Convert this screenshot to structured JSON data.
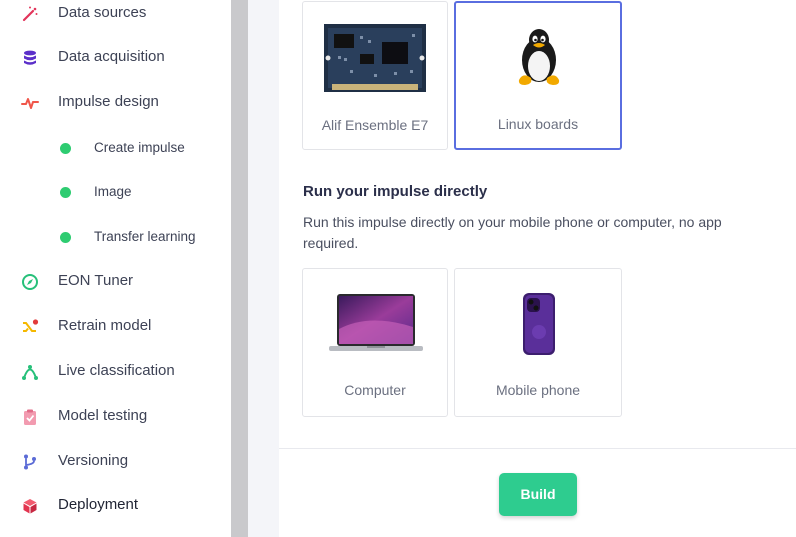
{
  "sidebar": {
    "items": [
      {
        "label": "Data sources",
        "icon": "magic-wand-icon"
      },
      {
        "label": "Data acquisition",
        "icon": "database-icon"
      },
      {
        "label": "Impulse design",
        "icon": "pulse-icon"
      },
      {
        "label": "EON Tuner",
        "icon": "compass-icon"
      },
      {
        "label": "Retrain model",
        "icon": "shuffle-icon"
      },
      {
        "label": "Live classification",
        "icon": "curve-icon"
      },
      {
        "label": "Model testing",
        "icon": "clipboard-check-icon"
      },
      {
        "label": "Versioning",
        "icon": "branch-icon"
      },
      {
        "label": "Deployment",
        "icon": "cube-icon"
      }
    ],
    "sub_items": [
      {
        "label": "Create impulse"
      },
      {
        "label": "Image"
      },
      {
        "label": "Transfer learning"
      }
    ]
  },
  "targets": {
    "boards": [
      {
        "label": "Alif Ensemble E7",
        "selected": false
      },
      {
        "label": "Linux boards",
        "selected": true
      }
    ],
    "direct": {
      "title": "Run your impulse directly",
      "description": "Run this impulse directly on your mobile phone or computer, no app required.",
      "options": [
        {
          "label": "Computer"
        },
        {
          "label": "Mobile phone"
        }
      ]
    }
  },
  "build_button": "Build",
  "colors": {
    "accent_green": "#2ecc8f",
    "selected_border": "#5a6ee0",
    "status_dot": "#2ecc71"
  }
}
